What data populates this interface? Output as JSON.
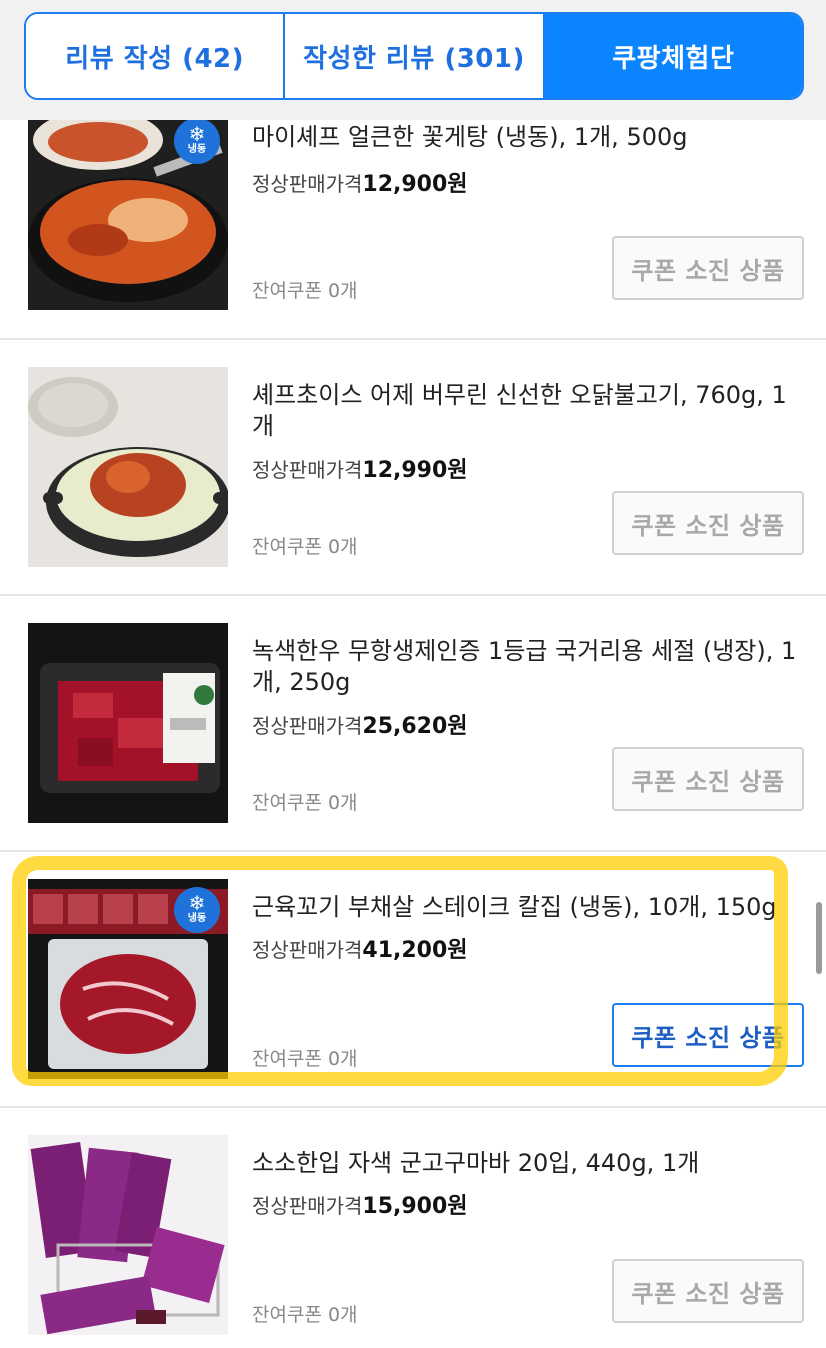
{
  "tabs": [
    {
      "label": "리뷰 작성 (42)"
    },
    {
      "label": "작성한 리뷰 (301)"
    },
    {
      "label": "쿠팡체험단"
    }
  ],
  "products": [
    {
      "name": "마이셰프 얼큰한 꽃게탕 (냉동), 1개, 500g",
      "price_label": "정상판매가격",
      "price": "12,900원",
      "coupon": "잔여쿠폰 0개",
      "button": "쿠폰 소진 상품",
      "badge": "냉동",
      "badge_icon": "snowflake-icon"
    },
    {
      "name": "셰프초이스 어제 버무린 신선한 오닭불고기, 760g, 1개",
      "price_label": "정상판매가격",
      "price": "12,990원",
      "coupon": "잔여쿠폰 0개",
      "button": "쿠폰 소진 상품"
    },
    {
      "name": "녹색한우 무항생제인증 1등급 국거리용 세절 (냉장), 1개, 250g",
      "price_label": "정상판매가격",
      "price": "25,620원",
      "coupon": "잔여쿠폰 0개",
      "button": "쿠폰 소진 상품"
    },
    {
      "name": "근육꼬기 부채살 스테이크 칼집 (냉동), 10개, 150g",
      "price_label": "정상판매가격",
      "price": "41,200원",
      "coupon": "잔여쿠폰 0개",
      "button": "쿠폰 소진 상품",
      "badge": "냉동",
      "badge_icon": "snowflake-icon"
    },
    {
      "name": "소소한입 자색 군고구마바 20입, 440g, 1개",
      "price_label": "정상판매가격",
      "price": "15,900원",
      "coupon": "잔여쿠폰 0개",
      "button": "쿠폰 소진 상품"
    }
  ],
  "colors": {
    "accent": "#0a84ff",
    "highlight": "#ffcd00"
  }
}
